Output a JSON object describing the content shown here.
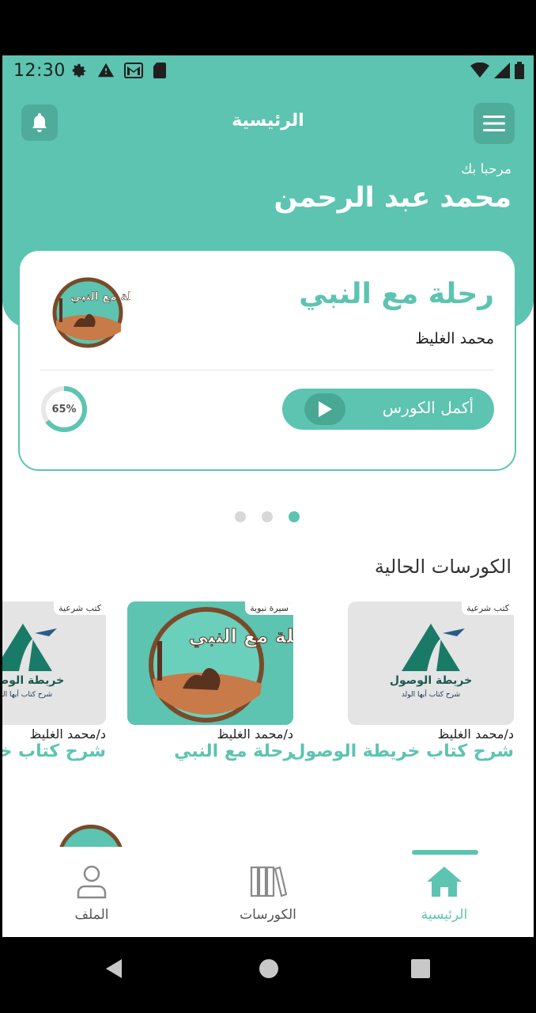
{
  "status_bar": {
    "time": "12:30"
  },
  "header": {
    "title": "الرئيسية",
    "greeting": "مرحبا بك",
    "user_name": "محمد عبد الرحمن"
  },
  "featured_course": {
    "title": "رحلة مع النبي",
    "author": "محمد الغليظ",
    "progress_percent": 65,
    "progress_label": "65%",
    "continue_label": "أكمل الكورس",
    "logo_text": "رحلة مع النبي"
  },
  "carousel": {
    "count": 3,
    "active_index": 2
  },
  "current_courses": {
    "section_title": "الكورسات الحالية",
    "items": [
      {
        "tag": "كتب شرعية",
        "author": "د/محمد الغليظ",
        "title": "شرح كتاب خريطة الوصول",
        "thumb_title": "خريطة الوصول",
        "thumb_subtitle": "شرح كتاب أيها الولد"
      },
      {
        "tag": "سيرة نبوية",
        "author": "د/محمد الغليظ",
        "title": "رحلة مع النبي",
        "thumb_title": "رحلة مع النبي"
      },
      {
        "tag": "كتب شرعية",
        "author": "د/محمد الغليظ",
        "title": "شرح كتاب خريطة الوصول",
        "thumb_title": "خريطة الوصول",
        "thumb_subtitle": "شرح كتاب أيها الولد"
      }
    ]
  },
  "bottom_nav": {
    "items": [
      {
        "label": "الملف",
        "icon": "user-icon"
      },
      {
        "label": "الكورسات",
        "icon": "books-icon"
      },
      {
        "label": "الرئيسية",
        "icon": "home-icon"
      }
    ],
    "active": "الرئيسية"
  },
  "colors": {
    "accent": "#5cc4b0",
    "accent_dark": "#49a894",
    "inactive": "#8a8a8a"
  }
}
